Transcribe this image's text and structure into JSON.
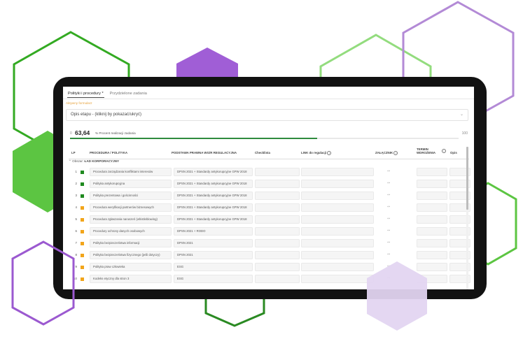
{
  "colors": {
    "hex_green": "#33aa22",
    "hex_light_green": "#8fd87a",
    "hex_purple": "#9b59d0",
    "hex_lavender": "#b38ad6",
    "progress_fill": "#2e8b3e",
    "status_green": "#1f8a1f",
    "status_orange": "#f2a51a"
  },
  "tabs": [
    {
      "label": "Polityki i procedury *"
    },
    {
      "label": "Przydzielone zadania"
    }
  ],
  "active_forms_label": "Aktywny formularz",
  "accordion": {
    "label": "Opis etapu - (kliknij by pokazać/ukryć)",
    "icon": "chevron-down-icon"
  },
  "progress": {
    "min": "0",
    "value": "63,64",
    "fraction": 0.6364,
    "label": "% Procent realizacji zadania",
    "max": "100"
  },
  "table": {
    "headers": {
      "lp": "LP",
      "procedure": "PROCEDURA / POLITYKA",
      "legal_basis": "PODSTAWA PRAWNA WG/R REGULACYJNA",
      "checklist": "Checklista",
      "link": "LINK do regulacji",
      "attachment": "ZAŁĄCZNIK",
      "deadline_1": "TERMIN",
      "deadline_2": "WDROŻENIA",
      "description": "Opis"
    },
    "group": {
      "label": "Obszar:",
      "name": "ŁAD KORPORACYJNY"
    },
    "rows": [
      {
        "lp": "1",
        "status": "green",
        "procedure": "Procedura zarządzania konfliktami interesów",
        "basis": "DPSN 2021 + Standardy antykorupcyjne GPW 2018"
      },
      {
        "lp": "2",
        "status": "green",
        "procedure": "Polityka antykorupcyjna",
        "basis": "DPSN 2021 + Standardy antykorupcyjne GPW 2018"
      },
      {
        "lp": "3",
        "status": "green",
        "procedure": "Polityka prezentowa i gościnności",
        "basis": "DPSN 2021 + Standardy antykorupcyjne GPW 2018"
      },
      {
        "lp": "4",
        "status": "orange",
        "procedure": "Procedura weryfikacji partnerów biznesowych",
        "basis": "DPSN 2021 + Standardy antykorupcyjne GPW 2018"
      },
      {
        "lp": "5",
        "status": "orange",
        "procedure": "Procedura zgłaszania naruszeń (whistleblowing)",
        "basis": "DPSN 2021 + Standardy antykorupcyjne GPW 2018"
      },
      {
        "lp": "6",
        "status": "orange",
        "procedure": "Procedury ochrony danych osobowych",
        "basis": "DPSN 2021 + RODO"
      },
      {
        "lp": "7",
        "status": "orange",
        "procedure": "Polityka bezpieczeństwa informacji",
        "basis": "DPSN 2021"
      },
      {
        "lp": "8",
        "status": "orange",
        "procedure": "Polityka bezpieczeństwa fizycznego (jeśli dotyczy)",
        "basis": "DPSN 2021"
      },
      {
        "lp": "9",
        "status": "orange",
        "procedure": "Polityka praw człowieka",
        "basis": "ESG"
      },
      {
        "lp": "10",
        "status": "orange",
        "procedure": "Kodeks etyczny dla stron 3",
        "basis": "ESG"
      }
    ]
  }
}
